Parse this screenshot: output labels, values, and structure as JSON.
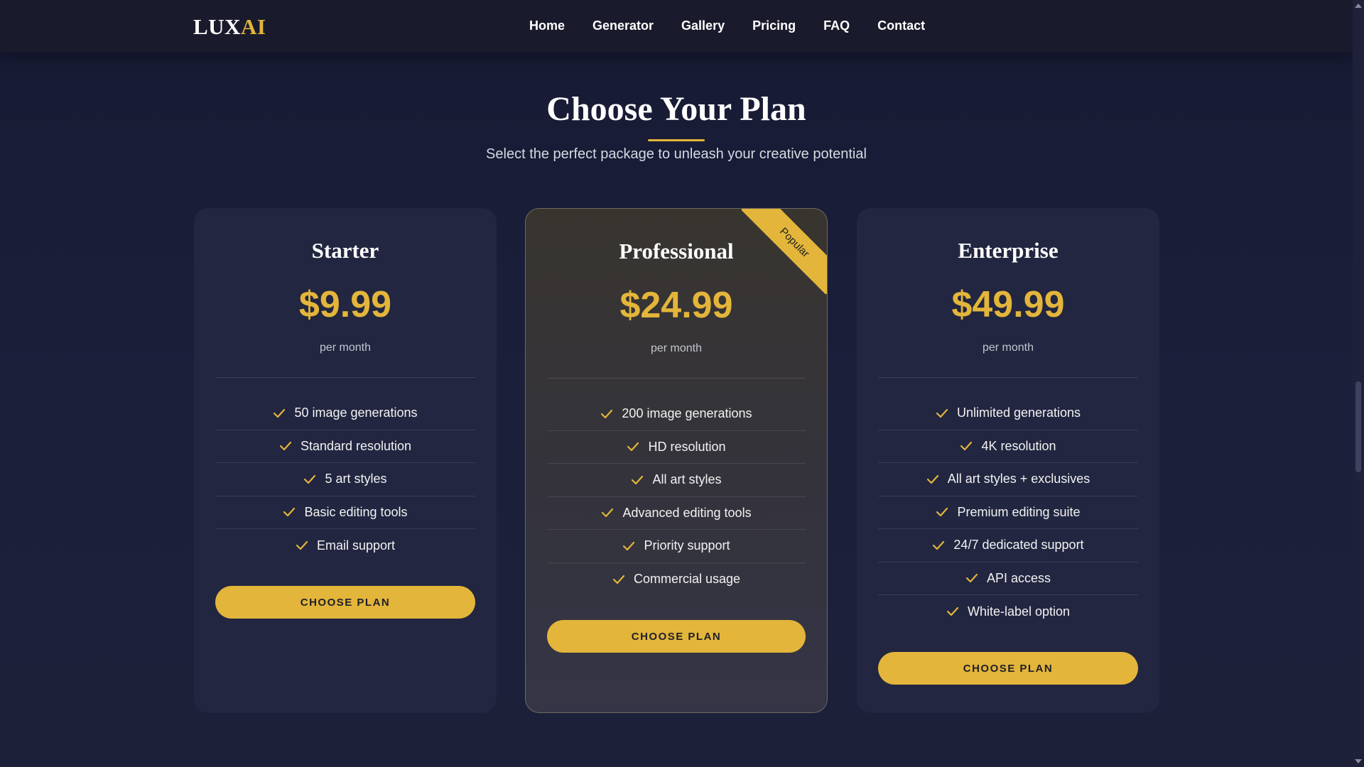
{
  "nav": {
    "logo_main": "LUX",
    "logo_accent": "AI",
    "links": [
      "Home",
      "Generator",
      "Gallery",
      "Pricing",
      "FAQ",
      "Contact"
    ]
  },
  "header": {
    "title": "Choose Your Plan",
    "subtitle": "Select the perfect package to unleash your creative potential"
  },
  "plans": [
    {
      "name": "Starter",
      "price": "$9.99",
      "period": "per month",
      "features": [
        "50 image generations",
        "Standard resolution",
        "5 art styles",
        "Basic editing tools",
        "Email support"
      ],
      "button": "CHOOSE PLAN"
    },
    {
      "name": "Professional",
      "price": "$24.99",
      "period": "per month",
      "badge": "Popular",
      "features": [
        "200 image generations",
        "HD resolution",
        "All art styles",
        "Advanced editing tools",
        "Priority support",
        "Commercial usage"
      ],
      "button": "CHOOSE PLAN"
    },
    {
      "name": "Enterprise",
      "price": "$49.99",
      "period": "per month",
      "features": [
        "Unlimited generations",
        "4K resolution",
        "All art styles + exclusives",
        "Premium editing suite",
        "24/7 dedicated support",
        "API access",
        "White-label option"
      ],
      "button": "CHOOSE PLAN"
    }
  ],
  "colors": {
    "accent": "#e3b53a",
    "background": "#1a1d36",
    "card": "#222640",
    "featured_card": "#36343a"
  },
  "icons": {
    "feature": "check-icon"
  }
}
